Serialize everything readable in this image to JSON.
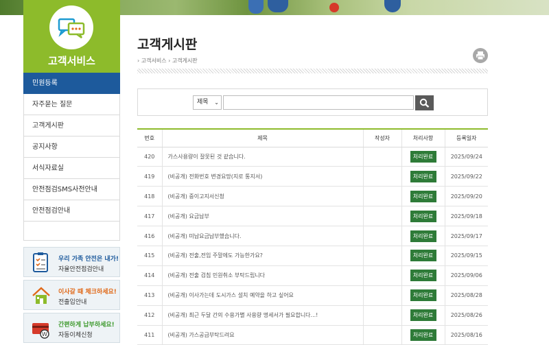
{
  "sidebar": {
    "title": "고객서비스",
    "items": [
      {
        "label": "민원등록",
        "active": true
      },
      {
        "label": "자주묻는 질문",
        "active": false
      },
      {
        "label": "고객게시판",
        "active": false
      },
      {
        "label": "공지사항",
        "active": false
      },
      {
        "label": "서식자료실",
        "active": false
      },
      {
        "label": "안전점검SMS사전안내",
        "active": false
      },
      {
        "label": "안전점검안내",
        "active": false
      }
    ],
    "promos": [
      {
        "title": "우리 가족 안전은 내가!",
        "subtitle": "자율안전점검안내",
        "title_color": "#1d5a9c",
        "icon": "checklist-icon"
      },
      {
        "title": "이사갈 때 체크하세요!",
        "subtitle": "전출입안내",
        "title_color": "#e06a1a",
        "icon": "house-icon"
      },
      {
        "title": "간편하게 납부하세요!",
        "subtitle": "자동이체신청",
        "title_color": "#3f9a2e",
        "icon": "card-icon"
      }
    ]
  },
  "main": {
    "title": "고객게시판",
    "breadcrumb": [
      "고객서비스",
      "고객게시판"
    ],
    "print_icon": "printer-icon",
    "search": {
      "select_value": "제목",
      "input_value": "",
      "button_icon": "search-icon"
    },
    "table": {
      "columns": [
        "번호",
        "제목",
        "작성자",
        "처리사항",
        "등록일자"
      ],
      "rows": [
        {
          "no": "420",
          "title": "가스사용량이 잘못된 것 같습니다.",
          "author": "",
          "status": "처리완료",
          "date": "2025/09/24"
        },
        {
          "no": "419",
          "title": "(비공개) 전화번호 변경요망(지로 통지서)",
          "author": "",
          "status": "처리완료",
          "date": "2025/09/22"
        },
        {
          "no": "418",
          "title": "(비공개) 중이고지서신청",
          "author": "",
          "status": "처리완료",
          "date": "2025/09/20"
        },
        {
          "no": "417",
          "title": "(비공개) 요금납부",
          "author": "",
          "status": "처리완료",
          "date": "2025/09/18"
        },
        {
          "no": "416",
          "title": "(비공개) 미납요금납부했습니다.",
          "author": "",
          "status": "처리완료",
          "date": "2025/09/17"
        },
        {
          "no": "415",
          "title": "(비공개) 전출,전입 주말에도 가능한가요?",
          "author": "",
          "status": "처리완료",
          "date": "2025/09/15"
        },
        {
          "no": "414",
          "title": "(비공개) 전출 검침 민원취소 부탁드립니다",
          "author": "",
          "status": "처리완료",
          "date": "2025/09/06"
        },
        {
          "no": "413",
          "title": "(비공개) 이사가는데 도시가스 설치 예약을 하고 싶어요",
          "author": "",
          "status": "처리완료",
          "date": "2025/08/28"
        },
        {
          "no": "412",
          "title": "(비공개) 최근 두달 간의 수용가별 사용량 명세서가 필요합니다...!",
          "author": "",
          "status": "처리완료",
          "date": "2025/08/26"
        },
        {
          "no": "411",
          "title": "(비공개) 가스공급부탁드려요",
          "author": "",
          "status": "처리완료",
          "date": "2025/08/16"
        }
      ]
    }
  },
  "colors": {
    "sidebar_green": "#8dbb2b",
    "active_blue": "#1d5a9c",
    "badge_green": "#2e7b38"
  }
}
